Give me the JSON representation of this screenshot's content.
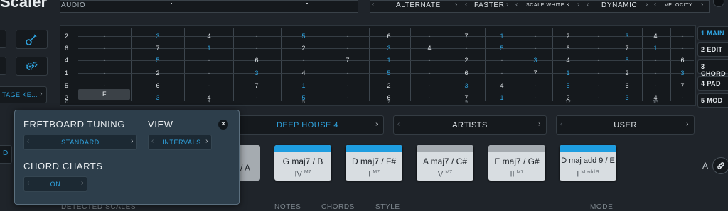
{
  "app": {
    "title_fragment": "Scaler"
  },
  "top_bar": {
    "audio_label": "AUDIO",
    "selects": [
      {
        "label": "ALTERNATE"
      },
      {
        "label": "FASTER"
      },
      {
        "label": "SCALE WHITE K..."
      },
      {
        "label": "DYNAMIC"
      },
      {
        "label": "VELOCITY"
      }
    ]
  },
  "left_panel": {
    "instrument_selector": "TAGE KE..."
  },
  "fretboard": {
    "strings": [
      {
        "open": "2",
        "cells": [
          "-",
          "3",
          "4",
          "-",
          "5",
          "-",
          "6",
          "-",
          "7",
          "1",
          "-",
          "2",
          "-",
          "3",
          "4",
          "-"
        ]
      },
      {
        "open": "6",
        "cells": [
          "-",
          "7",
          "1",
          "-",
          "2",
          "-",
          "3",
          "4",
          "-",
          "5",
          "-",
          "6",
          "-",
          "7",
          "1",
          "-"
        ]
      },
      {
        "open": "4",
        "cells": [
          "-",
          "5",
          "-",
          "6",
          "-",
          "7",
          "1",
          "-",
          "2",
          "-",
          "3",
          "4",
          "-",
          "5",
          "-",
          "6"
        ]
      },
      {
        "open": "1",
        "cells": [
          "-",
          "2",
          "-",
          "3",
          "4",
          "-",
          "5",
          "-",
          "6",
          "-",
          "7",
          "1",
          "-",
          "2",
          "-",
          "3"
        ]
      },
      {
        "open": "5",
        "cells": [
          "-",
          "6",
          "-",
          "7",
          "1",
          "-",
          "2",
          "-",
          "3",
          "4",
          "-",
          "5",
          "-",
          "6",
          "-",
          "7"
        ]
      },
      {
        "open": "2",
        "cells": [
          "F",
          "3",
          "4",
          "-",
          "5",
          "-",
          "6",
          "-",
          "7",
          "1",
          "-",
          "2",
          "-",
          "3",
          "4",
          "-"
        ]
      }
    ],
    "blue_degrees": [
      "1",
      "3",
      "5"
    ],
    "fret_numbers": [
      {
        "fret": 0,
        "label": "0"
      },
      {
        "fret": 3,
        "label": "3"
      },
      {
        "fret": 5,
        "label": "5"
      },
      {
        "fret": 7,
        "label": "7"
      },
      {
        "fret": 9,
        "label": "9"
      },
      {
        "fret": 12,
        "label": "12"
      },
      {
        "fret": 15,
        "label": "15"
      }
    ]
  },
  "right_tabs": [
    {
      "num": "1",
      "label": "MAIN",
      "active": true
    },
    {
      "num": "2",
      "label": "EDIT",
      "active": false
    },
    {
      "num": "3",
      "label": "CHORD",
      "active": false
    },
    {
      "num": "4",
      "label": "PAD",
      "active": false
    },
    {
      "num": "5",
      "label": "MOD",
      "active": false
    }
  ],
  "preset_row": {
    "genre": "DEEP HOUSE 4",
    "artists": "ARTISTS",
    "user": "USER"
  },
  "chord_cards": [
    {
      "partial_name": "/ A"
    },
    {
      "name": "G maj7 / B",
      "roman": "IV",
      "ext": "M7",
      "color": "#1e9de0"
    },
    {
      "name": "D maj7 / F#",
      "roman": "I",
      "ext": "M7",
      "color": "#1e9de0"
    },
    {
      "name": "A maj7 / C#",
      "roman": "V",
      "ext": "M7",
      "color": "#a4aaaf"
    },
    {
      "name": "E maj7 / G#",
      "roman": "II",
      "ext": "M7",
      "color": "#a4aaaf"
    },
    {
      "name": "D maj add 9 / E",
      "roman": "I",
      "ext": "M add 9",
      "color": "#1e9de0"
    }
  ],
  "side_labels": {
    "right_letter": "A",
    "left_stub_letter": "D"
  },
  "bottom_labels": [
    "DETECTED SCALES",
    "NOTES",
    "CHORDS",
    "STYLE",
    "MODE"
  ],
  "popup": {
    "fretboard_tuning_title": "FRETBOARD TUNING",
    "fretboard_tuning_value": "STANDARD",
    "view_title": "VIEW",
    "view_value": "INTERVALS",
    "chord_charts_title": "CHORD CHARTS",
    "chord_charts_value": "ON",
    "close_label": "×"
  },
  "colors": {
    "accent": "#2fa4e0",
    "background": "#1f242a",
    "popup": "#2d3e4b"
  }
}
